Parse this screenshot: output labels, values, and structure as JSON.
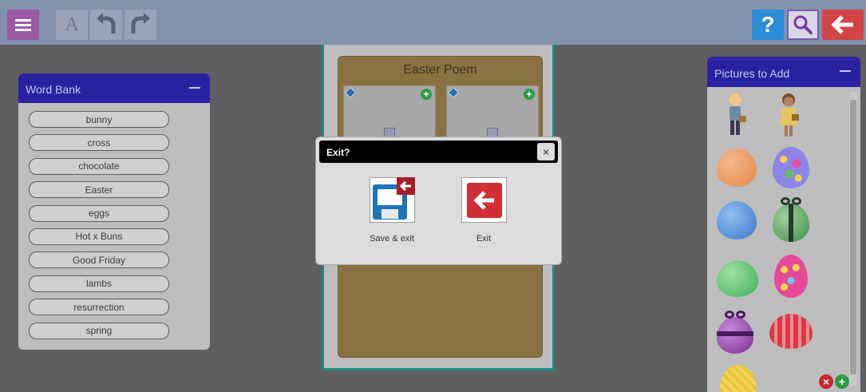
{
  "toolbar": {
    "items": [
      {
        "name": "menu",
        "icon": "hamburger-icon"
      },
      {
        "name": "font",
        "icon": "font-icon",
        "glyph": "A"
      },
      {
        "name": "undo",
        "icon": "undo-icon"
      },
      {
        "name": "redo",
        "icon": "redo-icon"
      },
      {
        "name": "help",
        "icon": "help-icon",
        "glyph": "?"
      },
      {
        "name": "search",
        "icon": "search-icon"
      },
      {
        "name": "back",
        "icon": "arrow-left-icon"
      }
    ]
  },
  "word_bank": {
    "title": "Word Bank",
    "words": [
      "bunny",
      "cross",
      "chocolate",
      "Easter",
      "eggs",
      "Hot x Buns",
      "Good Friday",
      "lambs",
      "resurrection",
      "spring"
    ]
  },
  "poem": {
    "title": "Easter Poem"
  },
  "pictures": {
    "title": "Pictures to Add",
    "items": [
      "boy-with-basket",
      "girl-with-basket",
      "orange-egg",
      "blue-spotted-egg",
      "blue-egg",
      "green-ribbon-egg",
      "green-egg",
      "pink-spotted-egg",
      "purple-ribbon-egg",
      "red-striped-egg",
      "yellow-egg"
    ]
  },
  "dialog": {
    "title": "Exit?",
    "close_glyph": "×",
    "save_exit_label": "Save & exit",
    "exit_label": "Exit"
  },
  "colors": {
    "toolbar": "#8392ad",
    "panel_header": "#2723a1",
    "menu_button": "#9b5aa4",
    "help_button": "#2b8ed6",
    "back_button": "#d34446",
    "poem_card": "#8a7141"
  }
}
